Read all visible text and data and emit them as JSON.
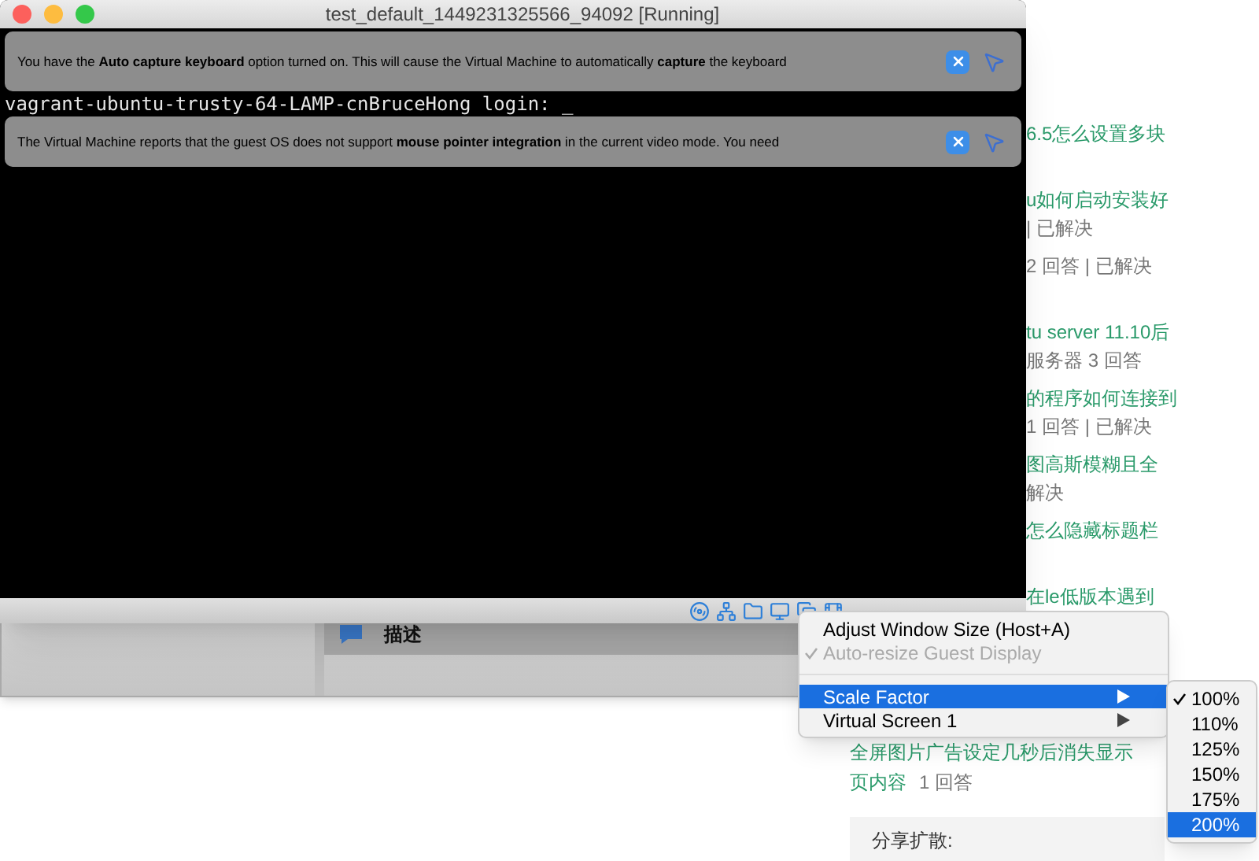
{
  "background_page": {
    "right_column": [
      {
        "title": "6.5怎么设置多块"
      },
      {
        "title": "u如何启动安装好",
        "meta": "| 已解决"
      },
      {
        "meta": "2 回答 | 已解决"
      },
      {
        "title": "tu server 11.10后",
        "meta": "服务器  3 回答"
      },
      {
        "title": "的程序如何连接到",
        "meta": "1 回答 | 已解决"
      },
      {
        "title": "图高斯模糊且全",
        "meta": "解决"
      },
      {
        "title": "怎么隐藏标题栏"
      },
      {
        "title": "在le低版本遇到"
      }
    ],
    "lower_item": {
      "title": "全屏图片广告设定几秒后消失显示",
      "title_2": "页内容",
      "meta": "1 回答"
    },
    "share_label": "分享扩散:"
  },
  "manager_window": {
    "section_title": "描述"
  },
  "vm_window": {
    "title": "test_default_1449231325566_94092 [Running]",
    "console_line": "vagrant-ubuntu-trusty-64-LAMP-cnBruceHong login: _",
    "notices": [
      {
        "text": "You have the **Auto capture keyboard** option turned on. This will cause the Virtual Machine to automatically **capture** the keyboard"
      },
      {
        "text": "The Virtual Machine reports that the guest OS does not support **mouse pointer integration** in the current video mode. You need"
      }
    ]
  },
  "context_menu": {
    "items": [
      {
        "kind": "item",
        "label": "Adjust Window Size (Host+A)",
        "disabled": false,
        "checked": false,
        "selected": false
      },
      {
        "kind": "item",
        "label": "Auto-resize Guest Display",
        "disabled": true,
        "checked": true,
        "selected": false
      },
      {
        "kind": "separator"
      },
      {
        "kind": "submenu",
        "label": "Scale Factor",
        "disabled": false,
        "checked": false,
        "selected": true
      },
      {
        "kind": "submenu",
        "label": "Virtual Screen 1",
        "disabled": false,
        "checked": false,
        "selected": false
      }
    ]
  },
  "submenu": {
    "items": [
      {
        "label": "100%",
        "checked": true,
        "selected": false
      },
      {
        "label": "110%",
        "checked": false,
        "selected": false
      },
      {
        "label": "125%",
        "checked": false,
        "selected": false
      },
      {
        "label": "150%",
        "checked": false,
        "selected": false
      },
      {
        "label": "175%",
        "checked": false,
        "selected": false
      },
      {
        "label": "200%",
        "checked": false,
        "selected": true
      }
    ]
  }
}
